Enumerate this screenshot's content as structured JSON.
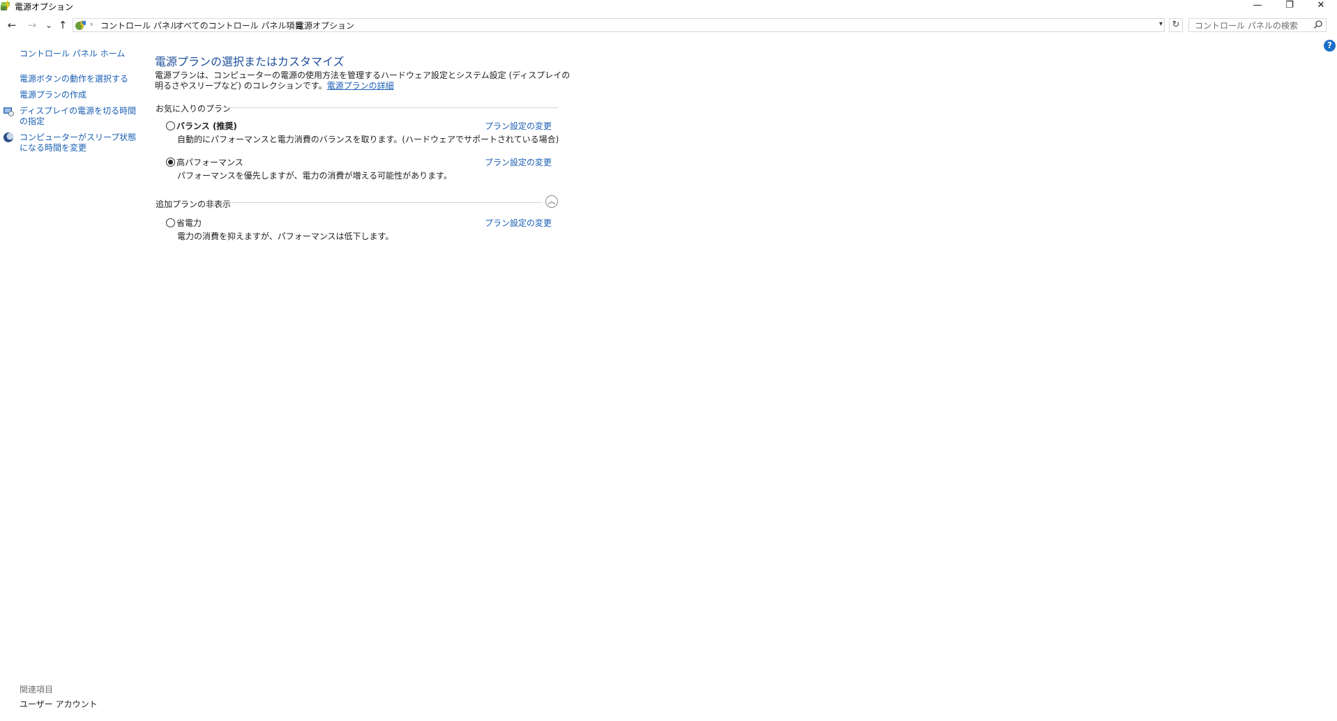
{
  "window": {
    "title": "電源オプション",
    "minimize": "—",
    "restore": "❐",
    "close": "✕"
  },
  "nav": {
    "back": "←",
    "forward": "→",
    "recent": "⌄",
    "up": "↑"
  },
  "breadcrumb": [
    "コントロール パネル",
    "すべてのコントロール パネル項目",
    "電源オプション"
  ],
  "breadcrumb_sep": "›",
  "search": {
    "placeholder": "コントロール パネルの検索"
  },
  "refresh": "↻",
  "help": "?",
  "sidebar": {
    "home": "コントロール パネル ホーム",
    "items": [
      {
        "label": "電源ボタンの動作を選択する"
      },
      {
        "label": "電源プランの作成"
      },
      {
        "label": "ディスプレイの電源を切る時間の指定",
        "icon": "display-power-icon"
      },
      {
        "label": "コンピューターがスリープ状態になる時間を変更",
        "icon": "sleep-moon-icon"
      }
    ],
    "related_heading": "関連項目",
    "related_items": [
      "ユーザー アカウント"
    ]
  },
  "main": {
    "title": "電源プランの選択またはカスタマイズ",
    "description": "電源プランは、コンピューターの電源の使用方法を管理するハードウェア設定とシステム設定 (ディスプレイの明るさやスリープなど) のコレクションです。",
    "details_link": "電源プランの詳細",
    "favorites_heading": "お気に入りのプラン",
    "hidden_heading": "追加プランの非表示",
    "change_label": "プラン設定の変更",
    "plans": [
      {
        "name": "バランス (推奨)",
        "desc": "自動的にパフォーマンスと電力消費のバランスを取ります。(ハードウェアでサポートされている場合)",
        "selected": false
      },
      {
        "name": "高パフォーマンス",
        "desc": "パフォーマンスを優先しますが、電力の消費が増える可能性があります。",
        "selected": true
      },
      {
        "name": "省電力",
        "desc": "電力の消費を抑えますが、パフォーマンスは低下します。",
        "selected": false
      }
    ]
  }
}
